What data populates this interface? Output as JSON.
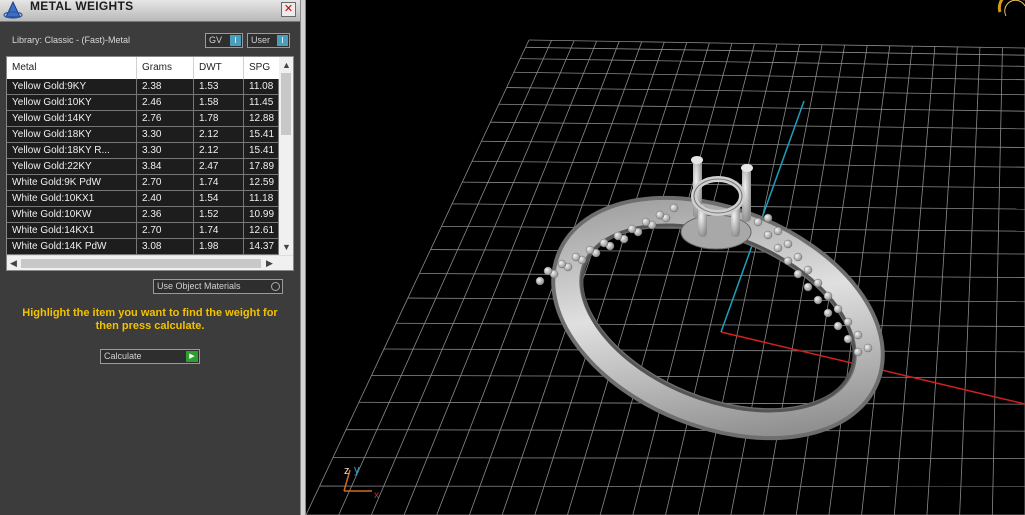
{
  "panel": {
    "title": "METAL WEIGHTS",
    "close_glyph": "✕",
    "library_label": "Library: Classic - (Fast)-Metal",
    "toggles": [
      {
        "label": "GV",
        "switch": "I"
      },
      {
        "label": "User",
        "switch": "I"
      }
    ],
    "table": {
      "columns": [
        "Metal",
        "Grams",
        "DWT",
        "SPG"
      ],
      "rows": [
        [
          "Yellow Gold:9KY",
          "2.38",
          "1.53",
          "11.08"
        ],
        [
          "Yellow Gold:10KY",
          "2.46",
          "1.58",
          "11.45"
        ],
        [
          "Yellow Gold:14KY",
          "2.76",
          "1.78",
          "12.88"
        ],
        [
          "Yellow Gold:18KY",
          "3.30",
          "2.12",
          "15.41"
        ],
        [
          "Yellow Gold:18KY R...",
          "3.30",
          "2.12",
          "15.41"
        ],
        [
          "Yellow Gold:22KY",
          "3.84",
          "2.47",
          "17.89"
        ],
        [
          "White Gold:9K PdW",
          "2.70",
          "1.74",
          "12.59"
        ],
        [
          "White Gold:10KX1",
          "2.40",
          "1.54",
          "11.18"
        ],
        [
          "White Gold:10KW",
          "2.36",
          "1.52",
          "10.99"
        ],
        [
          "White Gold:14KX1",
          "2.70",
          "1.74",
          "12.61"
        ],
        [
          "White Gold:14K PdW",
          "3.08",
          "1.98",
          "14.37"
        ]
      ]
    },
    "use_object_materials": "Use Object Materials",
    "instruction": "Highlight the item you want to find the weight for then press calculate.",
    "calculate_label": "Calculate",
    "colors": {
      "accent_yellow": "#f2c200",
      "toggle_blue": "#4a9dbd",
      "calc_green": "#2e9f2e"
    }
  },
  "viewport": {
    "axis_labels": {
      "x": "x",
      "y": "y",
      "z": "z"
    },
    "colors": {
      "grid": "#8a8a8a",
      "x_axis": "#d42020",
      "y_axis": "#1f9ec0",
      "ring": "#c4c4c4"
    }
  }
}
